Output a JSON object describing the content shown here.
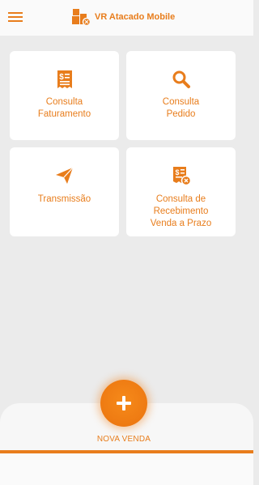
{
  "app": {
    "title": "VR Atacado Mobile",
    "accent_color": "#e87d1c"
  },
  "header": {
    "menu_icon": "hamburger-menu-icon",
    "logo_icon": "boxes-logo-icon"
  },
  "cards": [
    {
      "icon": "invoice-dollar-icon",
      "lines": [
        "Consulta",
        "Faturamento"
      ]
    },
    {
      "icon": "search-icon",
      "lines": [
        "Consulta",
        "Pedido"
      ]
    },
    {
      "icon": "paper-plane-icon",
      "lines": [
        "Transmissão"
      ]
    },
    {
      "icon": "receipt-clock-icon",
      "lines": [
        "Consulta de",
        "Recebimento",
        "Venda a Prazo"
      ]
    }
  ],
  "fab": {
    "icon": "plus-icon",
    "label": "NOVA VENDA"
  }
}
